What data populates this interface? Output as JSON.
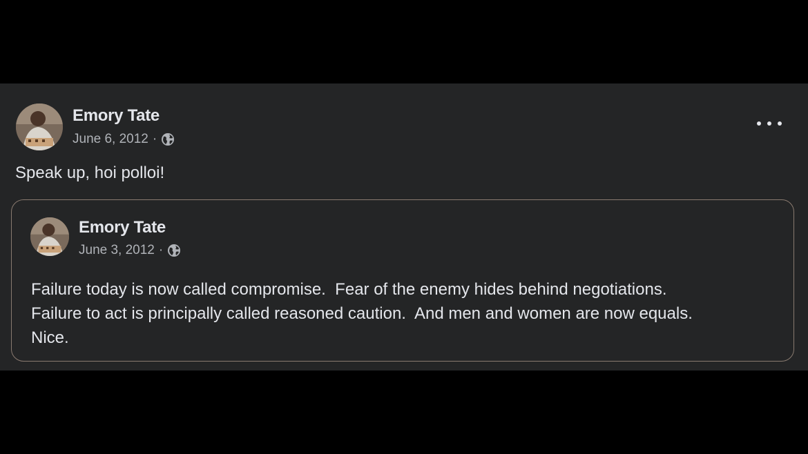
{
  "post": {
    "author": "Emory Tate",
    "date": "June 6, 2012",
    "separator": "·",
    "audience_icon": "globe-icon",
    "text": "Speak up, hoi polloi!"
  },
  "shared_post": {
    "author": "Emory Tate",
    "date": "June 3, 2012",
    "separator": "·",
    "audience_icon": "globe-icon",
    "lines": [
      "Failure today is now called compromise.  Fear of the enemy hides behind negotiations.",
      "Failure to act is principally called reasoned caution.  And men and women are now equals.",
      "Nice."
    ]
  },
  "colors": {
    "page_background": "#000000",
    "card_background": "#242526",
    "primary_text": "#e4e6eb",
    "secondary_text": "#b0b3b8",
    "shared_border": "#8a7b70"
  }
}
